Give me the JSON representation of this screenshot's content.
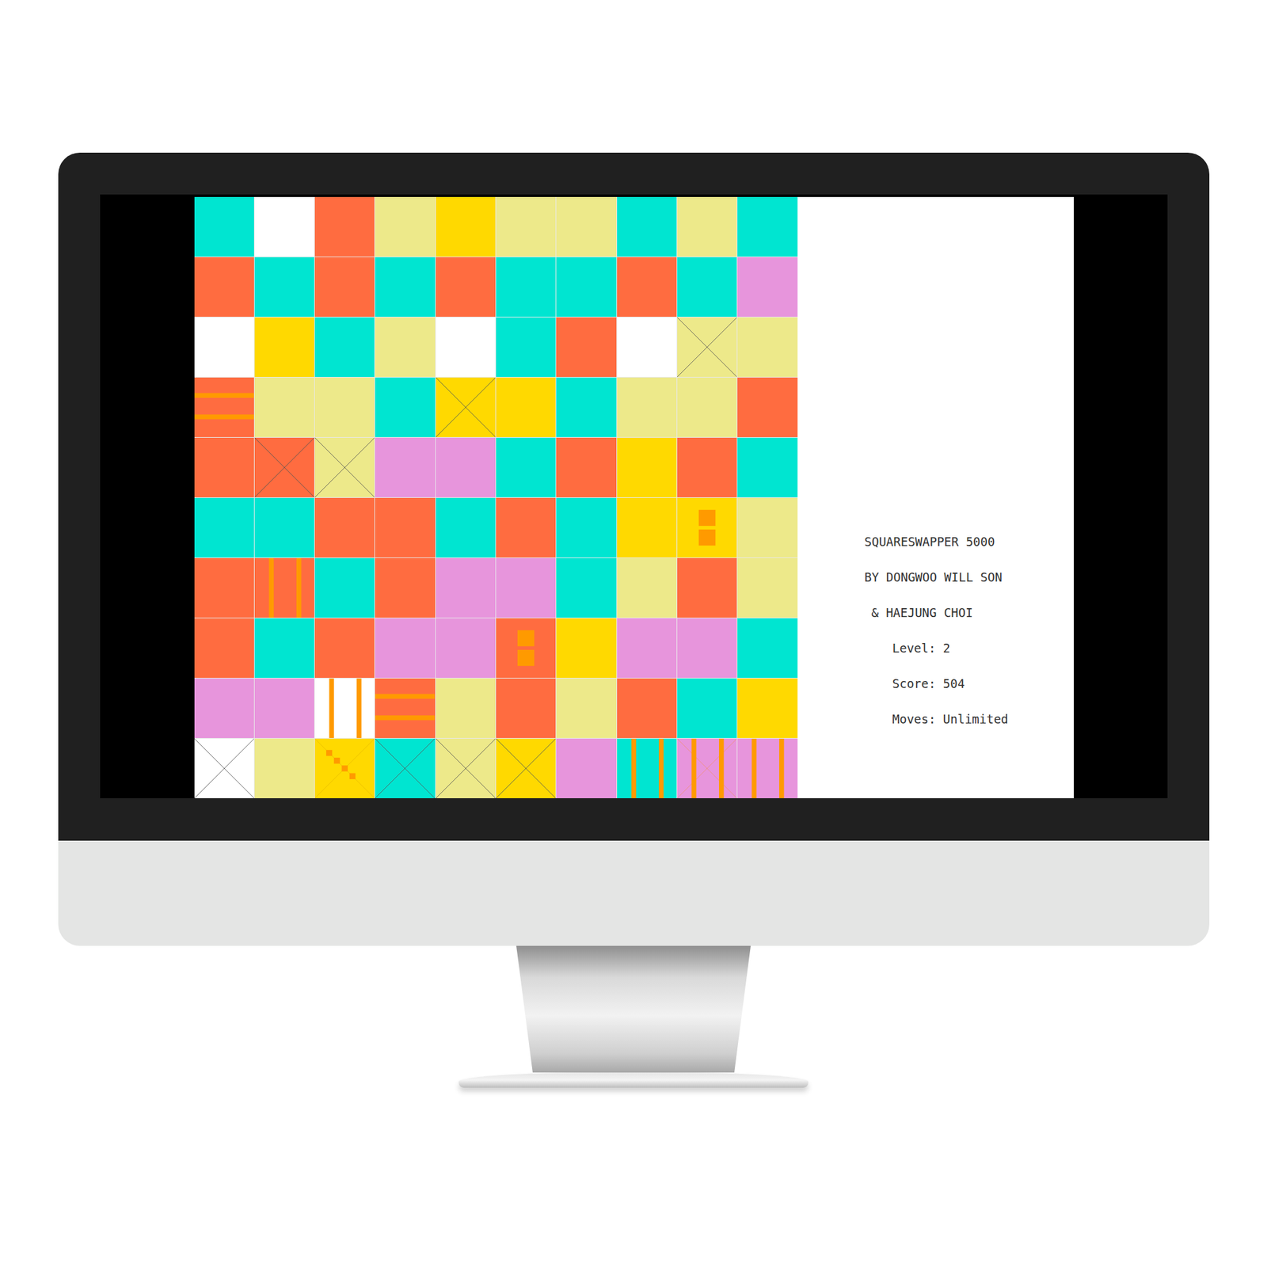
{
  "grid": {
    "rows": [
      [
        {
          "color": "#00e5d1",
          "kind": "plain"
        },
        {
          "color": "#ffffff",
          "kind": "plain"
        },
        {
          "color": "#ff6c40",
          "kind": "plain"
        },
        {
          "color": "#ede98a",
          "kind": "plain"
        },
        {
          "color": "#ffd900",
          "kind": "plain"
        },
        {
          "color": "#ede98a",
          "kind": "plain"
        },
        {
          "color": "#ede98a",
          "kind": "plain"
        },
        {
          "color": "#00e5d1",
          "kind": "plain"
        },
        {
          "color": "#ede98a",
          "kind": "plain"
        },
        {
          "color": "#00e5d1",
          "kind": "plain"
        }
      ],
      [
        {
          "color": "#ff6c40",
          "kind": "plain"
        },
        {
          "color": "#00e5d1",
          "kind": "plain"
        },
        {
          "color": "#ff6c40",
          "kind": "plain"
        },
        {
          "color": "#00e5d1",
          "kind": "plain"
        },
        {
          "color": "#ff6c40",
          "kind": "plain"
        },
        {
          "color": "#00e5d1",
          "kind": "plain"
        },
        {
          "color": "#00e5d1",
          "kind": "plain"
        },
        {
          "color": "#ff6c40",
          "kind": "plain"
        },
        {
          "color": "#00e5d1",
          "kind": "plain"
        },
        {
          "color": "#e795dc",
          "kind": "plain"
        }
      ],
      [
        {
          "color": "#ffffff",
          "kind": "plain"
        },
        {
          "color": "#ffd900",
          "kind": "plain"
        },
        {
          "color": "#00e5d1",
          "kind": "plain"
        },
        {
          "color": "#ede98a",
          "kind": "plain"
        },
        {
          "color": "#ffffff",
          "kind": "plain"
        },
        {
          "color": "#00e5d1",
          "kind": "plain"
        },
        {
          "color": "#ff6c40",
          "kind": "plain"
        },
        {
          "color": "#ffffff",
          "kind": "plain"
        },
        {
          "color": "#ede98a",
          "kind": "cross"
        },
        {
          "color": "#ede98a",
          "kind": "plain"
        }
      ],
      [
        {
          "color": "#ff6c40",
          "kind": "hstripe"
        },
        {
          "color": "#ede98a",
          "kind": "plain"
        },
        {
          "color": "#ede98a",
          "kind": "plain"
        },
        {
          "color": "#00e5d1",
          "kind": "plain"
        },
        {
          "color": "#ffd900",
          "kind": "cross"
        },
        {
          "color": "#ffd900",
          "kind": "plain"
        },
        {
          "color": "#00e5d1",
          "kind": "plain"
        },
        {
          "color": "#ede98a",
          "kind": "plain"
        },
        {
          "color": "#ede98a",
          "kind": "plain"
        },
        {
          "color": "#ff6c40",
          "kind": "plain"
        }
      ],
      [
        {
          "color": "#ff6c40",
          "kind": "plain"
        },
        {
          "color": "#ff6c40",
          "kind": "cross"
        },
        {
          "color": "#ede98a",
          "kind": "cross"
        },
        {
          "color": "#e795dc",
          "kind": "plain"
        },
        {
          "color": "#e795dc",
          "kind": "plain"
        },
        {
          "color": "#00e5d1",
          "kind": "plain"
        },
        {
          "color": "#ff6c40",
          "kind": "plain"
        },
        {
          "color": "#ffd900",
          "kind": "plain"
        },
        {
          "color": "#ff6c40",
          "kind": "plain"
        },
        {
          "color": "#00e5d1",
          "kind": "plain"
        }
      ],
      [
        {
          "color": "#00e5d1",
          "kind": "plain"
        },
        {
          "color": "#00e5d1",
          "kind": "plain"
        },
        {
          "color": "#ff6c40",
          "kind": "plain"
        },
        {
          "color": "#ff6c40",
          "kind": "plain"
        },
        {
          "color": "#00e5d1",
          "kind": "plain"
        },
        {
          "color": "#ff6c40",
          "kind": "plain"
        },
        {
          "color": "#00e5d1",
          "kind": "plain"
        },
        {
          "color": "#ffd900",
          "kind": "plain"
        },
        {
          "color": "#ffd900",
          "kind": "bomb"
        },
        {
          "color": "#ede98a",
          "kind": "plain"
        }
      ],
      [
        {
          "color": "#ff6c40",
          "kind": "plain"
        },
        {
          "color": "#ff6c40",
          "kind": "vstripe"
        },
        {
          "color": "#00e5d1",
          "kind": "plain"
        },
        {
          "color": "#ff6c40",
          "kind": "plain"
        },
        {
          "color": "#e795dc",
          "kind": "plain"
        },
        {
          "color": "#e795dc",
          "kind": "plain"
        },
        {
          "color": "#00e5d1",
          "kind": "plain"
        },
        {
          "color": "#ede98a",
          "kind": "plain"
        },
        {
          "color": "#ff6c40",
          "kind": "plain"
        },
        {
          "color": "#ede98a",
          "kind": "plain"
        }
      ],
      [
        {
          "color": "#ff6c40",
          "kind": "plain"
        },
        {
          "color": "#00e5d1",
          "kind": "plain"
        },
        {
          "color": "#ff6c40",
          "kind": "plain"
        },
        {
          "color": "#e795dc",
          "kind": "plain"
        },
        {
          "color": "#e795dc",
          "kind": "plain"
        },
        {
          "color": "#ff6c40",
          "kind": "bomb"
        },
        {
          "color": "#ffd900",
          "kind": "plain"
        },
        {
          "color": "#e795dc",
          "kind": "plain"
        },
        {
          "color": "#e795dc",
          "kind": "plain"
        },
        {
          "color": "#00e5d1",
          "kind": "plain"
        }
      ],
      [
        {
          "color": "#e795dc",
          "kind": "plain"
        },
        {
          "color": "#e795dc",
          "kind": "plain"
        },
        {
          "color": "#ffffff",
          "kind": "vstripe"
        },
        {
          "color": "#ff6c40",
          "kind": "hstripe"
        },
        {
          "color": "#ede98a",
          "kind": "plain"
        },
        {
          "color": "#ff6c40",
          "kind": "plain"
        },
        {
          "color": "#ede98a",
          "kind": "plain"
        },
        {
          "color": "#ff6c40",
          "kind": "plain"
        },
        {
          "color": "#00e5d1",
          "kind": "plain"
        },
        {
          "color": "#ffd900",
          "kind": "plain"
        }
      ],
      [
        {
          "color": "#ffffff",
          "kind": "cross"
        },
        {
          "color": "#ede98a",
          "kind": "plain"
        },
        {
          "color": "#ffd900",
          "kind": "diagonal"
        },
        {
          "color": "#00e5d1",
          "kind": "cross"
        },
        {
          "color": "#ede98a",
          "kind": "cross"
        },
        {
          "color": "#ffd900",
          "kind": "cross"
        },
        {
          "color": "#e795dc",
          "kind": "plain"
        },
        {
          "color": "#00e5d1",
          "kind": "vstripe"
        },
        {
          "color": "#e795dc",
          "kind": "crossstripe"
        },
        {
          "color": "#e795dc",
          "kind": "vstripe"
        }
      ]
    ]
  },
  "info": {
    "title": "SQUARESWAPPER 5000",
    "authors": [
      "BY DONGWOO WILL SON",
      "& HAEJUNG CHOI"
    ],
    "level": "Level: 2",
    "score": "Score: 504",
    "moves": "Moves: Unlimited"
  }
}
